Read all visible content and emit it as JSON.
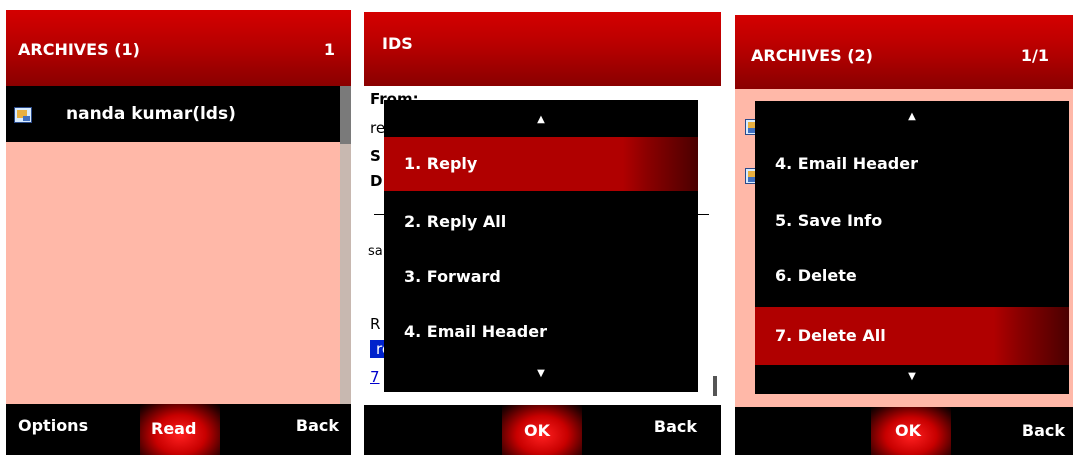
{
  "screen1": {
    "title": "ARCHIVES (1)",
    "page": "1",
    "list": [
      {
        "icon": "mail-icon",
        "label": "nanda kumar(lds)"
      }
    ],
    "softkeys": {
      "left": "Options",
      "center": "Read",
      "right": "Back"
    }
  },
  "screen2": {
    "title": "IDS",
    "background_text": {
      "from": "From:",
      "re": "re",
      "s": "S",
      "d": "D",
      "sa": "sa",
      "r": "R",
      "link": "re",
      "phone": "7"
    },
    "menu": {
      "up_arrow": "▲",
      "down_arrow": "▼",
      "items": [
        "1. Reply",
        "2. Reply All",
        "3. Forward",
        "4. Email Header"
      ],
      "selected_index": 0
    },
    "softkeys": {
      "center": "OK",
      "right": "Back"
    }
  },
  "screen3": {
    "title": "ARCHIVES (2)",
    "page": "1/1",
    "menu": {
      "up_arrow": "▲",
      "down_arrow": "▼",
      "items": [
        "4. Email Header",
        "5. Save Info",
        "6. Delete",
        "7. Delete All"
      ],
      "selected_index": 3
    },
    "softkeys": {
      "center": "OK",
      "right": "Back"
    }
  },
  "colors": {
    "title_red": "#c00000",
    "selection_red": "#b00000",
    "list_bg_pink": "#ffb8a8",
    "menu_bg": "#000000",
    "softbar_bg": "#000000",
    "link_blue": "#0000cc"
  }
}
